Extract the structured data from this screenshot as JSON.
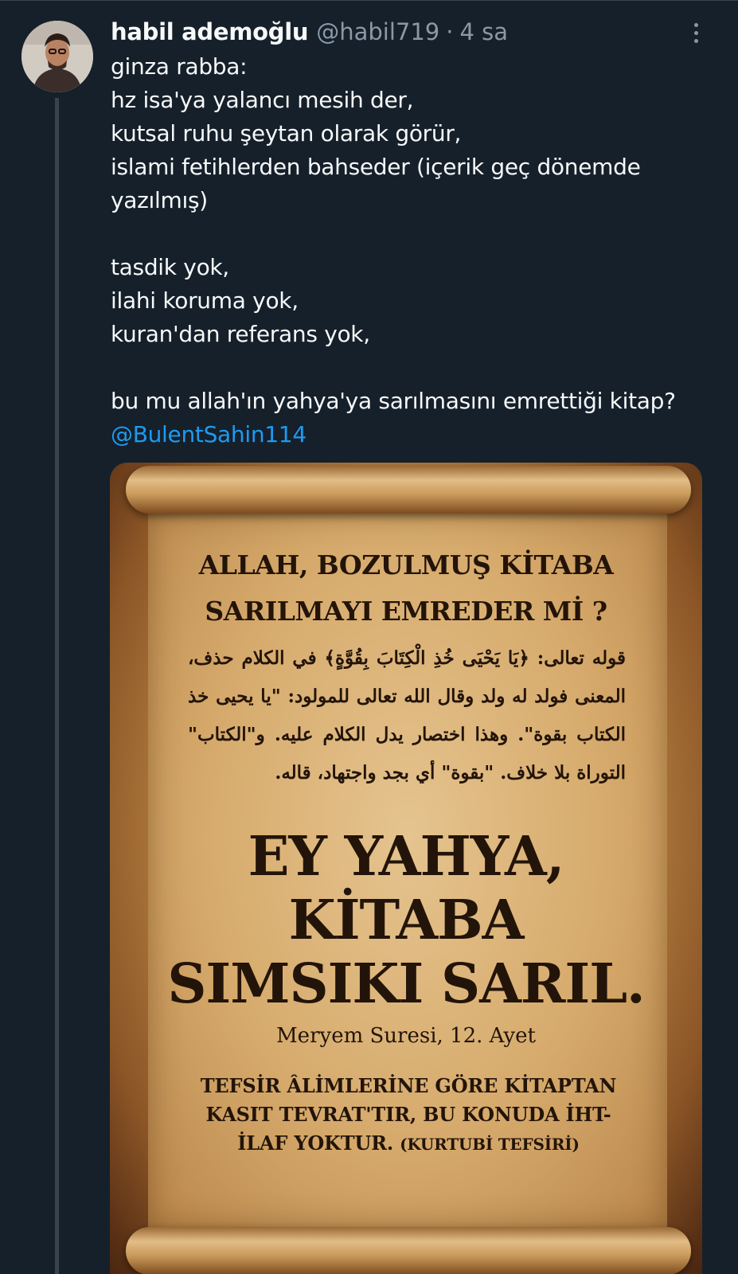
{
  "tweet": {
    "display_name": "habil ademoğlu",
    "handle": "@habil719",
    "separator": "·",
    "time": "4 sa",
    "text_lines": [
      "ginza rabba:",
      "hz isa'ya yalancı mesih der,",
      "kutsal ruhu şeytan olarak görür,",
      "islami fetihlerden bahseder (içerik geç dönemde",
      "yazılmış)",
      "",
      "tasdik yok,",
      "ilahi koruma yok,",
      "kuran'dan referans yok,",
      "",
      "bu mu allah'ın yahya'ya sarılmasını emrettiği kitap?"
    ],
    "mention": "@BulentSahin114",
    "icons": {
      "more": "more-options-icon",
      "avatar": "profile-photo"
    },
    "colors": {
      "background": "#15202b",
      "text": "#f7f9f9",
      "secondary": "#8b98a5",
      "link": "#1d9bf0"
    }
  },
  "image": {
    "question_line1": "ALLAH, BOZULMUŞ KİTABA",
    "question_line2": "SARILMAYI EMREDER Mİ ?",
    "arabic_text": "قوله تعالى: ﴿يَا يَحْيَى خُذِ الْكِتَابَ بِقُوَّةٍ﴾ في الكلام حذف، المعنى فولد له ولد وقال الله تعالى للمولود: \"يا يحيى خذ الكتاب بقوة\". وهذا اختصار يدل الكلام عليه. و\"الكتاب\" التوراة بلا خلاف. \"بقوة\" أي بجد واجتهاد، قاله.",
    "title_line1": "EY YAHYA,",
    "title_line2": "KİTABA",
    "title_line3": "SIMSIKI SARIL.",
    "reference": "Meryem Suresi, 12. Ayet",
    "note_line1": "TEFSİR ÂLİMLERİNE GÖRE KİTAPTAN",
    "note_line2": "KASIT TEVRAT'TIR, BU KONUDA İHT-",
    "note_line3": "İLAF YOKTUR.",
    "note_source": "(KURTUBİ TEFSİRİ)"
  }
}
